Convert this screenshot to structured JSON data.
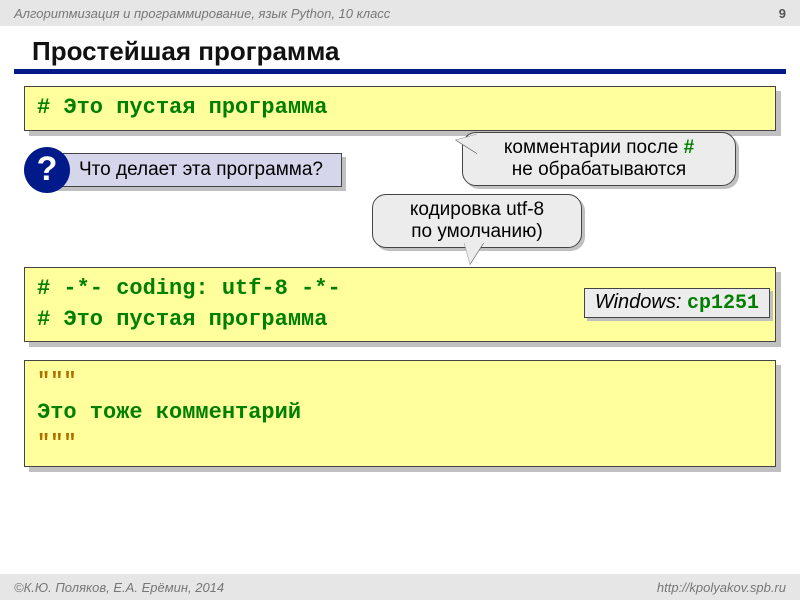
{
  "header": {
    "course": "Алгоритмизация и программирование, язык Python, 10 класс",
    "page": "9"
  },
  "title": "Простейшая программа",
  "codebox1": {
    "line1": "# Это пустая программа"
  },
  "question": {
    "badge": "?",
    "text": "Что делает эта программа?"
  },
  "callout1": {
    "line1_pre": "комментарии после ",
    "hash": "#",
    "line2": "не обрабатываются"
  },
  "callout2": {
    "line1": "кодировка utf-8",
    "line2": "по умолчанию)"
  },
  "codebox2": {
    "line1": "# -*- coding: utf-8 -*-",
    "line2": "# Это пустая программа"
  },
  "windows": {
    "label": "Windows:  ",
    "value": "cp1251"
  },
  "codebox3": {
    "q1": "\"\"\"",
    "body": "Это тоже комментарий",
    "q2": "\"\"\""
  },
  "footer": {
    "left": "©К.Ю. Поляков, Е.А. Ерёмин, 2014",
    "right": "http://kpolyakov.spb.ru"
  }
}
